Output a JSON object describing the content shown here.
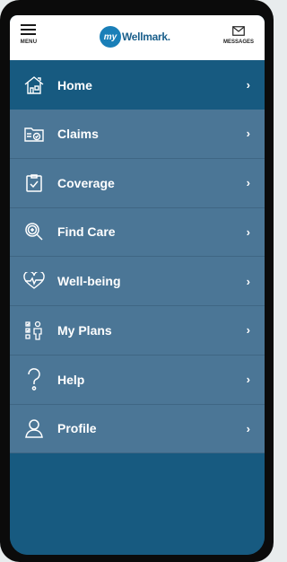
{
  "header": {
    "menu_label": "MENU",
    "logo_my": "my",
    "logo_brand": "Wellmark.",
    "messages_label": "MESSAGES"
  },
  "menu": {
    "items": [
      {
        "label": "Home",
        "icon": "home-icon",
        "active": true
      },
      {
        "label": "Claims",
        "icon": "claims-icon",
        "active": false
      },
      {
        "label": "Coverage",
        "icon": "coverage-icon",
        "active": false
      },
      {
        "label": "Find Care",
        "icon": "find-care-icon",
        "active": false
      },
      {
        "label": "Well-being",
        "icon": "well-being-icon",
        "active": false
      },
      {
        "label": "My Plans",
        "icon": "my-plans-icon",
        "active": false
      },
      {
        "label": "Help",
        "icon": "help-icon",
        "active": false
      },
      {
        "label": "Profile",
        "icon": "profile-icon",
        "active": false
      }
    ],
    "chevron": "›"
  },
  "colors": {
    "header_bg": "#ffffff",
    "menu_bg": "#4b7696",
    "active_bg": "#175a80",
    "brand_blue": "#1a7fb8"
  }
}
